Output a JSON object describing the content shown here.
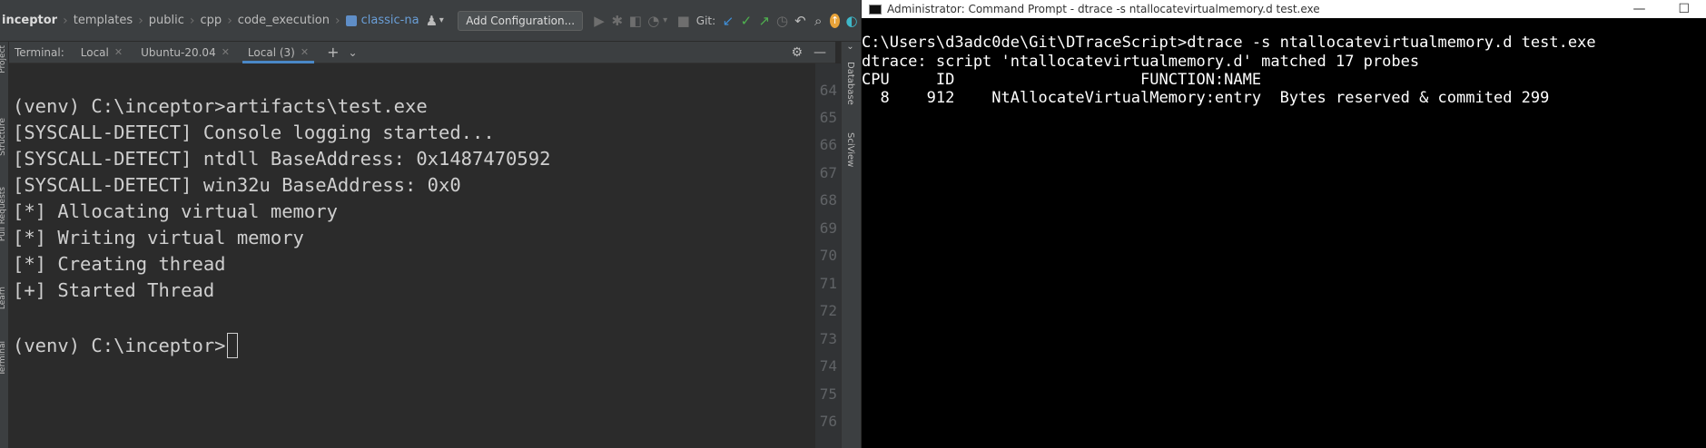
{
  "ide": {
    "breadcrumbs": [
      "inceptor",
      "templates",
      "public",
      "cpp",
      "code_execution"
    ],
    "run_config": "classic-na",
    "add_config_label": "Add Configuration...",
    "git_label": "Git:",
    "terminal_label": "Terminal:",
    "tabs": [
      {
        "label": "Local",
        "active": false
      },
      {
        "label": "Ubuntu-20.04",
        "active": false
      },
      {
        "label": "Local (3)",
        "active": true
      }
    ],
    "left_strip_labels": [
      "Project",
      "Structure",
      "Pull Requests",
      "Learn",
      "Terminal"
    ],
    "right_strip_labels": [
      "Database",
      "SciView"
    ],
    "terminal_lines": [
      "(venv) C:\\inceptor>artifacts\\test.exe",
      "[SYSCALL-DETECT] Console logging started...",
      "[SYSCALL-DETECT] ntdll BaseAddress: 0x1487470592",
      "[SYSCALL-DETECT] win32u BaseAddress: 0x0",
      "[*] Allocating virtual memory",
      "[*] Writing virtual memory",
      "[*] Creating thread",
      "[+] Started Thread",
      "",
      "(venv) C:\\inceptor>"
    ],
    "line_numbers": [
      "64",
      "65",
      "66",
      "67",
      "68",
      "69",
      "70",
      "71",
      "72",
      "73",
      "74",
      "75",
      "76"
    ]
  },
  "cmd": {
    "title": "Administrator: Command Prompt - dtrace  -s ntallocatevirtualmemory.d test.exe",
    "lines": [
      "C:\\Users\\d3adc0de\\Git\\DTraceScript>dtrace -s ntallocatevirtualmemory.d test.exe",
      "dtrace: script 'ntallocatevirtualmemory.d' matched 17 probes",
      "CPU     ID                    FUNCTION:NAME",
      "  8    912    NtAllocateVirtualMemory:entry  Bytes reserved & commited 299"
    ]
  },
  "colors": {
    "ide_bg": "#2b2b2b",
    "ide_panel": "#3c3f41",
    "tab_accent": "#4a88c7",
    "cmd_bg": "#000000",
    "cmd_fg": "#ffffff"
  }
}
